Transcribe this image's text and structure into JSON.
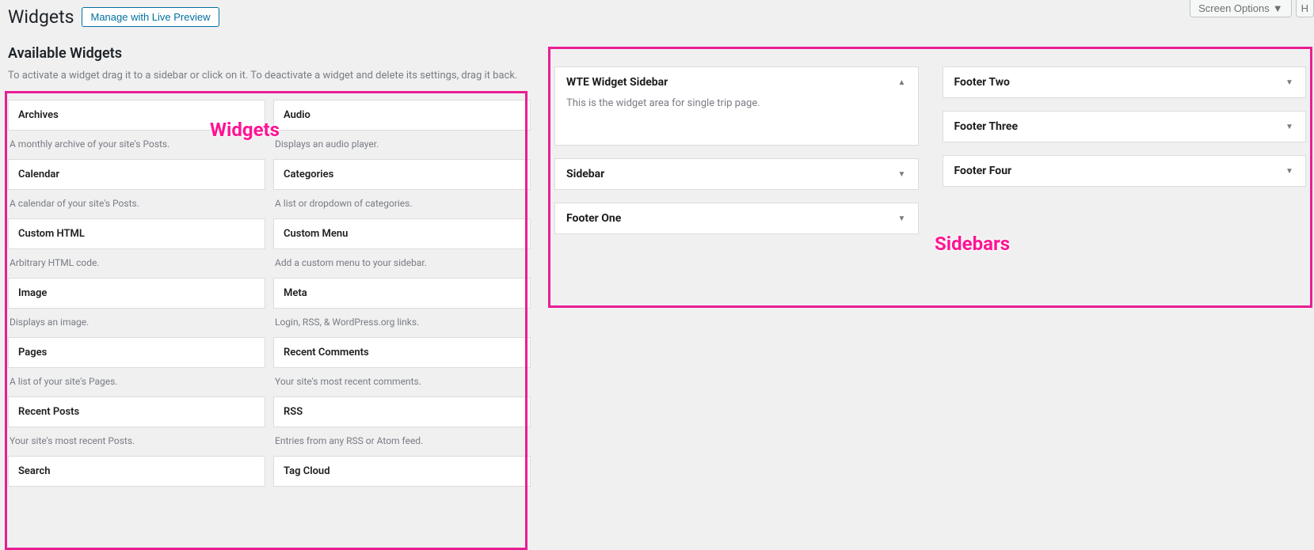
{
  "topbar": {
    "screen_options": "Screen Options",
    "help_fragment": "H"
  },
  "header": {
    "page_title": "Widgets",
    "preview_button": "Manage with Live Preview"
  },
  "available": {
    "title": "Available Widgets",
    "instruction": "To activate a widget drag it to a sidebar or click on it. To deactivate a widget and delete its settings, drag it back."
  },
  "widgets": [
    {
      "name": "Archives",
      "desc": "A monthly archive of your site's Posts."
    },
    {
      "name": "Audio",
      "desc": "Displays an audio player."
    },
    {
      "name": "Calendar",
      "desc": "A calendar of your site's Posts."
    },
    {
      "name": "Categories",
      "desc": "A list or dropdown of categories."
    },
    {
      "name": "Custom HTML",
      "desc": "Arbitrary HTML code."
    },
    {
      "name": "Custom Menu",
      "desc": "Add a custom menu to your sidebar."
    },
    {
      "name": "Image",
      "desc": "Displays an image."
    },
    {
      "name": "Meta",
      "desc": "Login, RSS, & WordPress.org links."
    },
    {
      "name": "Pages",
      "desc": "A list of your site's Pages."
    },
    {
      "name": "Recent Comments",
      "desc": "Your site's most recent comments."
    },
    {
      "name": "Recent Posts",
      "desc": "Your site's most recent Posts."
    },
    {
      "name": "RSS",
      "desc": "Entries from any RSS or Atom feed."
    },
    {
      "name": "Search",
      "desc": ""
    },
    {
      "name": "Tag Cloud",
      "desc": ""
    }
  ],
  "sidebars_left": [
    {
      "name": "WTE Widget Sidebar",
      "desc": "This is the widget area for single trip page.",
      "open": true
    },
    {
      "name": "Sidebar",
      "open": false
    },
    {
      "name": "Footer One",
      "open": false
    }
  ],
  "sidebars_right": [
    {
      "name": "Footer Two",
      "open": false
    },
    {
      "name": "Footer Three",
      "open": false
    },
    {
      "name": "Footer Four",
      "open": false
    }
  ],
  "annotations": {
    "widgets_label": "Widgets",
    "sidebars_label": "Sidebars"
  }
}
